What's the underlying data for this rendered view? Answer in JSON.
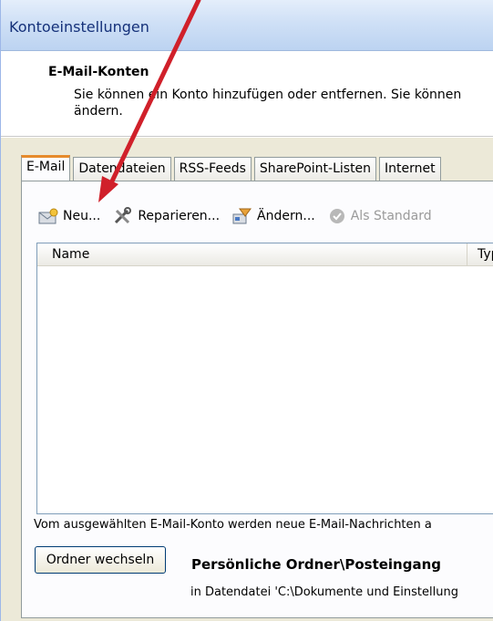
{
  "window": {
    "title": "Kontoeinstellungen"
  },
  "header": {
    "title": "E-Mail-Konten",
    "description_line1": "Sie können ein Konto hinzufügen oder entfernen. Sie können",
    "description_line2": "ändern."
  },
  "tabs": [
    {
      "label": "E-Mail",
      "active": true
    },
    {
      "label": "Datendateien",
      "active": false
    },
    {
      "label": "RSS-Feeds",
      "active": false
    },
    {
      "label": "SharePoint-Listen",
      "active": false
    },
    {
      "label": "Internet",
      "active": false
    }
  ],
  "toolbar": {
    "new_label": "Neu...",
    "repair_label": "Reparieren...",
    "change_label": "Ändern...",
    "default_label": "Als Standard"
  },
  "list": {
    "columns": [
      "Name",
      "Typ"
    ]
  },
  "footer": {
    "info_text": "Vom ausgewählten E-Mail-Konto werden neue E-Mail-Nachrichten a",
    "change_folder_label": "Ordner wechseln",
    "folder_title": "Persönliche Ordner\\Posteingang",
    "folder_path": "in Datendatei 'C:\\Dokumente und Einstellung"
  },
  "colors": {
    "annotation_arrow": "#d0202a",
    "active_tab_accent": "#e68b2c",
    "title_text": "#15317a"
  }
}
